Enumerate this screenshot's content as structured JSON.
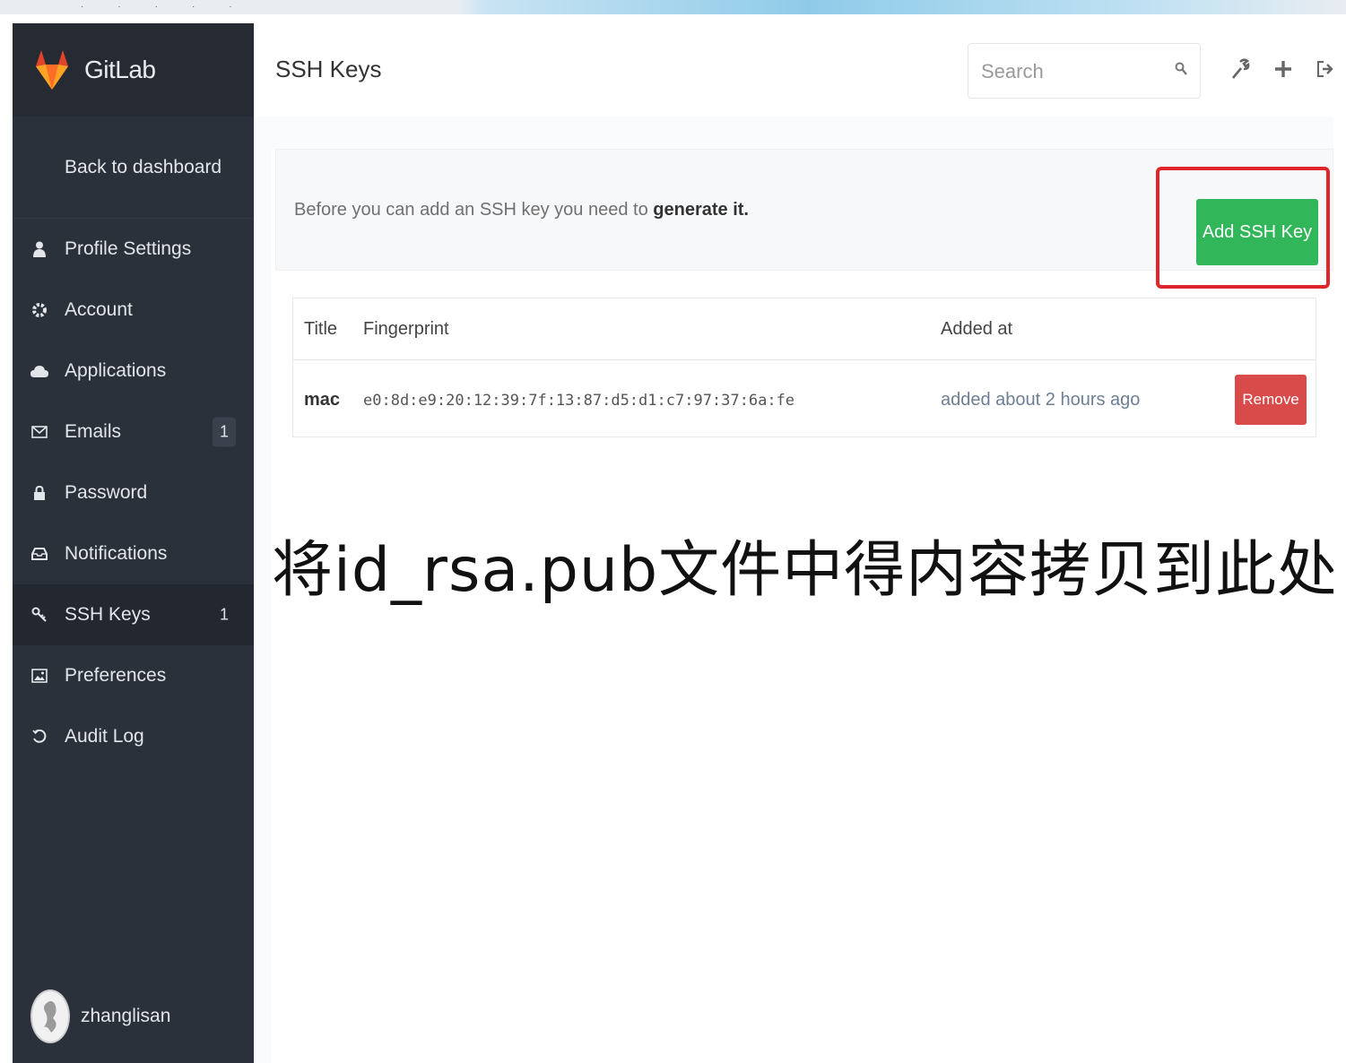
{
  "app": {
    "name": "GitLab"
  },
  "sidebar": {
    "back_label": "Back to dashboard",
    "items": [
      {
        "label": "Profile Settings",
        "icon": "user-icon"
      },
      {
        "label": "Account",
        "icon": "gear-icon"
      },
      {
        "label": "Applications",
        "icon": "cloud-icon"
      },
      {
        "label": "Emails",
        "icon": "envelope-icon",
        "count": "1"
      },
      {
        "label": "Password",
        "icon": "lock-icon"
      },
      {
        "label": "Notifications",
        "icon": "inbox-icon"
      },
      {
        "label": "SSH Keys",
        "icon": "key-icon",
        "count": "1",
        "active": true
      },
      {
        "label": "Preferences",
        "icon": "image-icon"
      },
      {
        "label": "Audit Log",
        "icon": "history-icon"
      }
    ],
    "user": {
      "name": "zhanglisan"
    }
  },
  "header": {
    "title": "SSH Keys",
    "search_placeholder": "Search",
    "icons": [
      "wrench-icon",
      "plus-icon",
      "sign-out-icon"
    ]
  },
  "notice": {
    "text": "Before you can add an SSH key you need to ",
    "link": "generate it."
  },
  "add_button": "Add SSH Key",
  "table": {
    "headers": [
      "Title",
      "Fingerprint",
      "Added at"
    ],
    "rows": [
      {
        "title": "mac",
        "fingerprint": "e0:8d:e9:20:12:39:7f:13:87:d5:d1:c7:97:37:6a:fe",
        "added": "added about 2 hours ago",
        "action": "Remove"
      }
    ]
  },
  "annotation": "将id_rsa.pub文件中得内容拷贝到此处",
  "colors": {
    "sidebar_bg": "#2b313b",
    "add_button": "#32b65a",
    "remove_button": "#d94a4a",
    "highlight": "#e0262a"
  }
}
